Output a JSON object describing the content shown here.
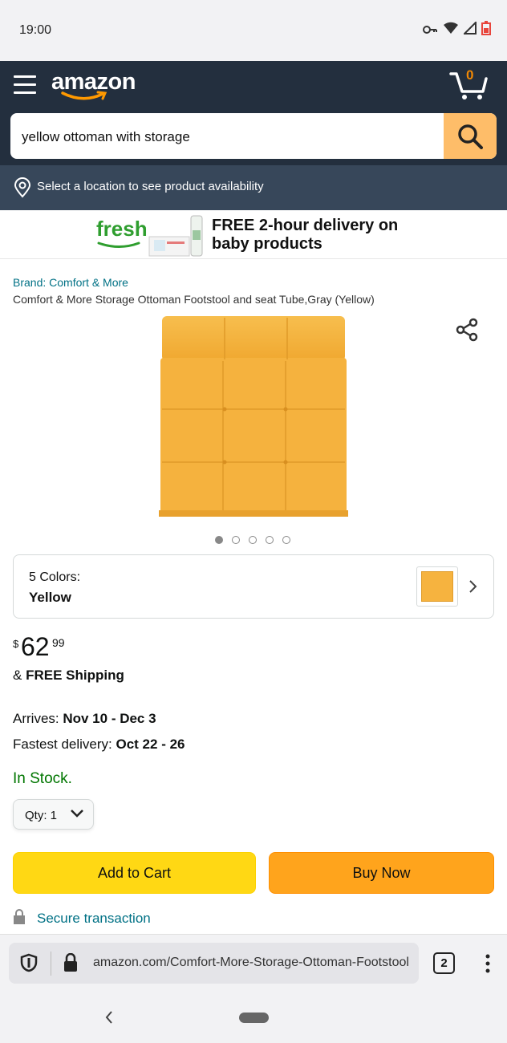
{
  "status_bar": {
    "time": "19:00",
    "battery_color": "#e8453c"
  },
  "header": {
    "logo_text": "amazon",
    "cart_count": "0",
    "search": {
      "value": "yellow ottoman with storage"
    }
  },
  "location": {
    "text": "Select a location to see product availability"
  },
  "banner": {
    "logo": "fresh",
    "text": "FREE 2-hour delivery on baby products"
  },
  "product": {
    "brand": "Brand: Comfort & More",
    "title": "Comfort & More Storage Ottoman Footstool and seat Tube,Gray (Yellow)",
    "image_dots": {
      "total": 5,
      "active": 0
    },
    "colors_label": "5 Colors:",
    "selected_color": "Yellow",
    "price_symbol": "$",
    "price_whole": "62",
    "price_fraction": "99",
    "shipping_prefix": "& ",
    "shipping_bold": "FREE Shipping",
    "arrives_label": "Arrives: ",
    "arrives_value": "Nov 10 - Dec 3",
    "fastest_label": "Fastest delivery: ",
    "fastest_value": "Oct 22 - 26",
    "stock": "In Stock.",
    "qty": "Qty:  1",
    "add_to_cart": "Add to Cart",
    "buy_now": "Buy Now",
    "secure": "Secure transaction"
  },
  "browser": {
    "url": "amazon.com/Comfort-More-Storage-Ottoman-Footstool",
    "tab_count": "2"
  },
  "colors": {
    "header_bg": "#232f3e",
    "location_bg": "#37475a",
    "search_btn": "#febd69",
    "add_to_cart": "#ffd814",
    "buy_now": "#ffa41c",
    "link": "#007185",
    "in_stock": "#007600",
    "product": "#f5b23e"
  }
}
